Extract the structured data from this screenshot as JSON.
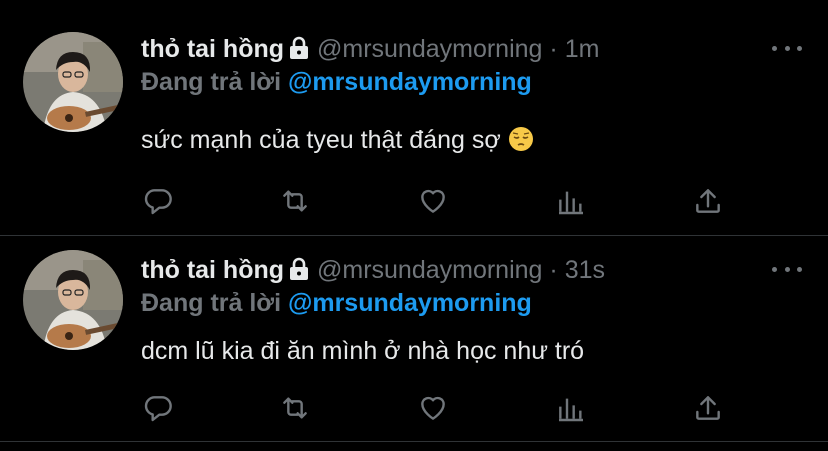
{
  "tweets": [
    {
      "name": "thỏ tai hồng",
      "handle": "@mrsundaymorning",
      "separator": "·",
      "time": "1m",
      "replying_prefix": "Đang trả lời",
      "replying_to": "@mrsundaymorning",
      "text": "sức mạnh của tyeu thật đáng sợ",
      "emoji": "pensive-face-emoji"
    },
    {
      "name": "thỏ tai hồng",
      "handle": "@mrsundaymorning",
      "separator": "·",
      "time": "31s",
      "replying_prefix": "Đang trả lời",
      "replying_to": "@mrsundaymorning",
      "text": "dcm lũ kia đi ăn mình ở nhà học như tró"
    }
  ],
  "icons": [
    "lock-icon",
    "more-icon",
    "reply-icon",
    "retweet-icon",
    "like-icon",
    "analytics-icon",
    "share-icon"
  ],
  "colors": {
    "background": "#000000",
    "text": "#e7e9ea",
    "secondary": "#71767b",
    "accent": "#1d9bf0",
    "divider": "#2f3336"
  }
}
